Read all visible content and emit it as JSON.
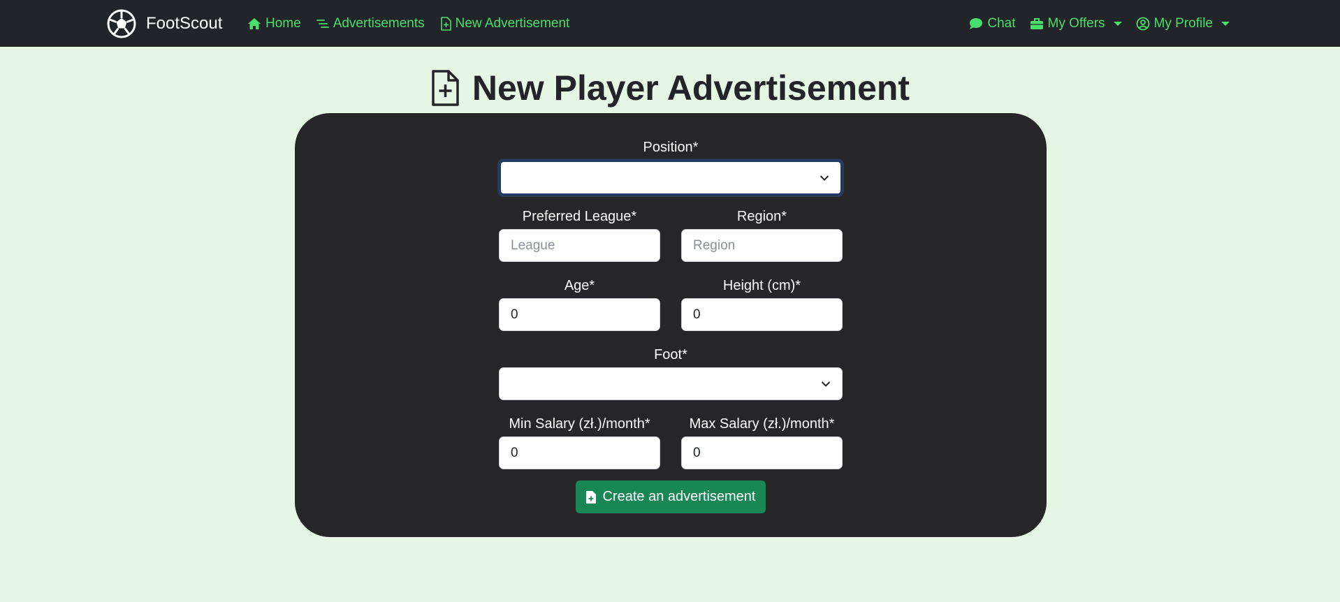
{
  "navbar": {
    "brand": "FootScout",
    "left_links": [
      {
        "label": "Home",
        "icon": "house-icon"
      },
      {
        "label": "Advertisements",
        "icon": "list-icon"
      },
      {
        "label": "New Advertisement",
        "icon": "file-plus-icon"
      }
    ],
    "right_links": [
      {
        "label": "Chat",
        "icon": "chat-icon"
      },
      {
        "label": "My Offers",
        "icon": "briefcase-icon"
      },
      {
        "label": "My Profile",
        "icon": "user-circle-icon"
      }
    ]
  },
  "page": {
    "title": "New Player Advertisement"
  },
  "form": {
    "position": {
      "label": "Position*",
      "value": ""
    },
    "league": {
      "label": "Preferred League*",
      "placeholder": "League",
      "value": ""
    },
    "region": {
      "label": "Region*",
      "placeholder": "Region",
      "value": ""
    },
    "age": {
      "label": "Age*",
      "value": "0"
    },
    "height": {
      "label": "Height (cm)*",
      "value": "0"
    },
    "foot": {
      "label": "Foot*",
      "value": ""
    },
    "min_salary": {
      "label": "Min Salary (zł.)/month*",
      "value": "0"
    },
    "max_salary": {
      "label": "Max Salary (zł.)/month*",
      "value": "0"
    },
    "submit_label": "Create an advertisement"
  },
  "colors": {
    "background": "#e5f6e4",
    "navbar": "#212529",
    "nav_link": "#4ade6a",
    "card": "#262527",
    "submit_button": "#198754"
  }
}
